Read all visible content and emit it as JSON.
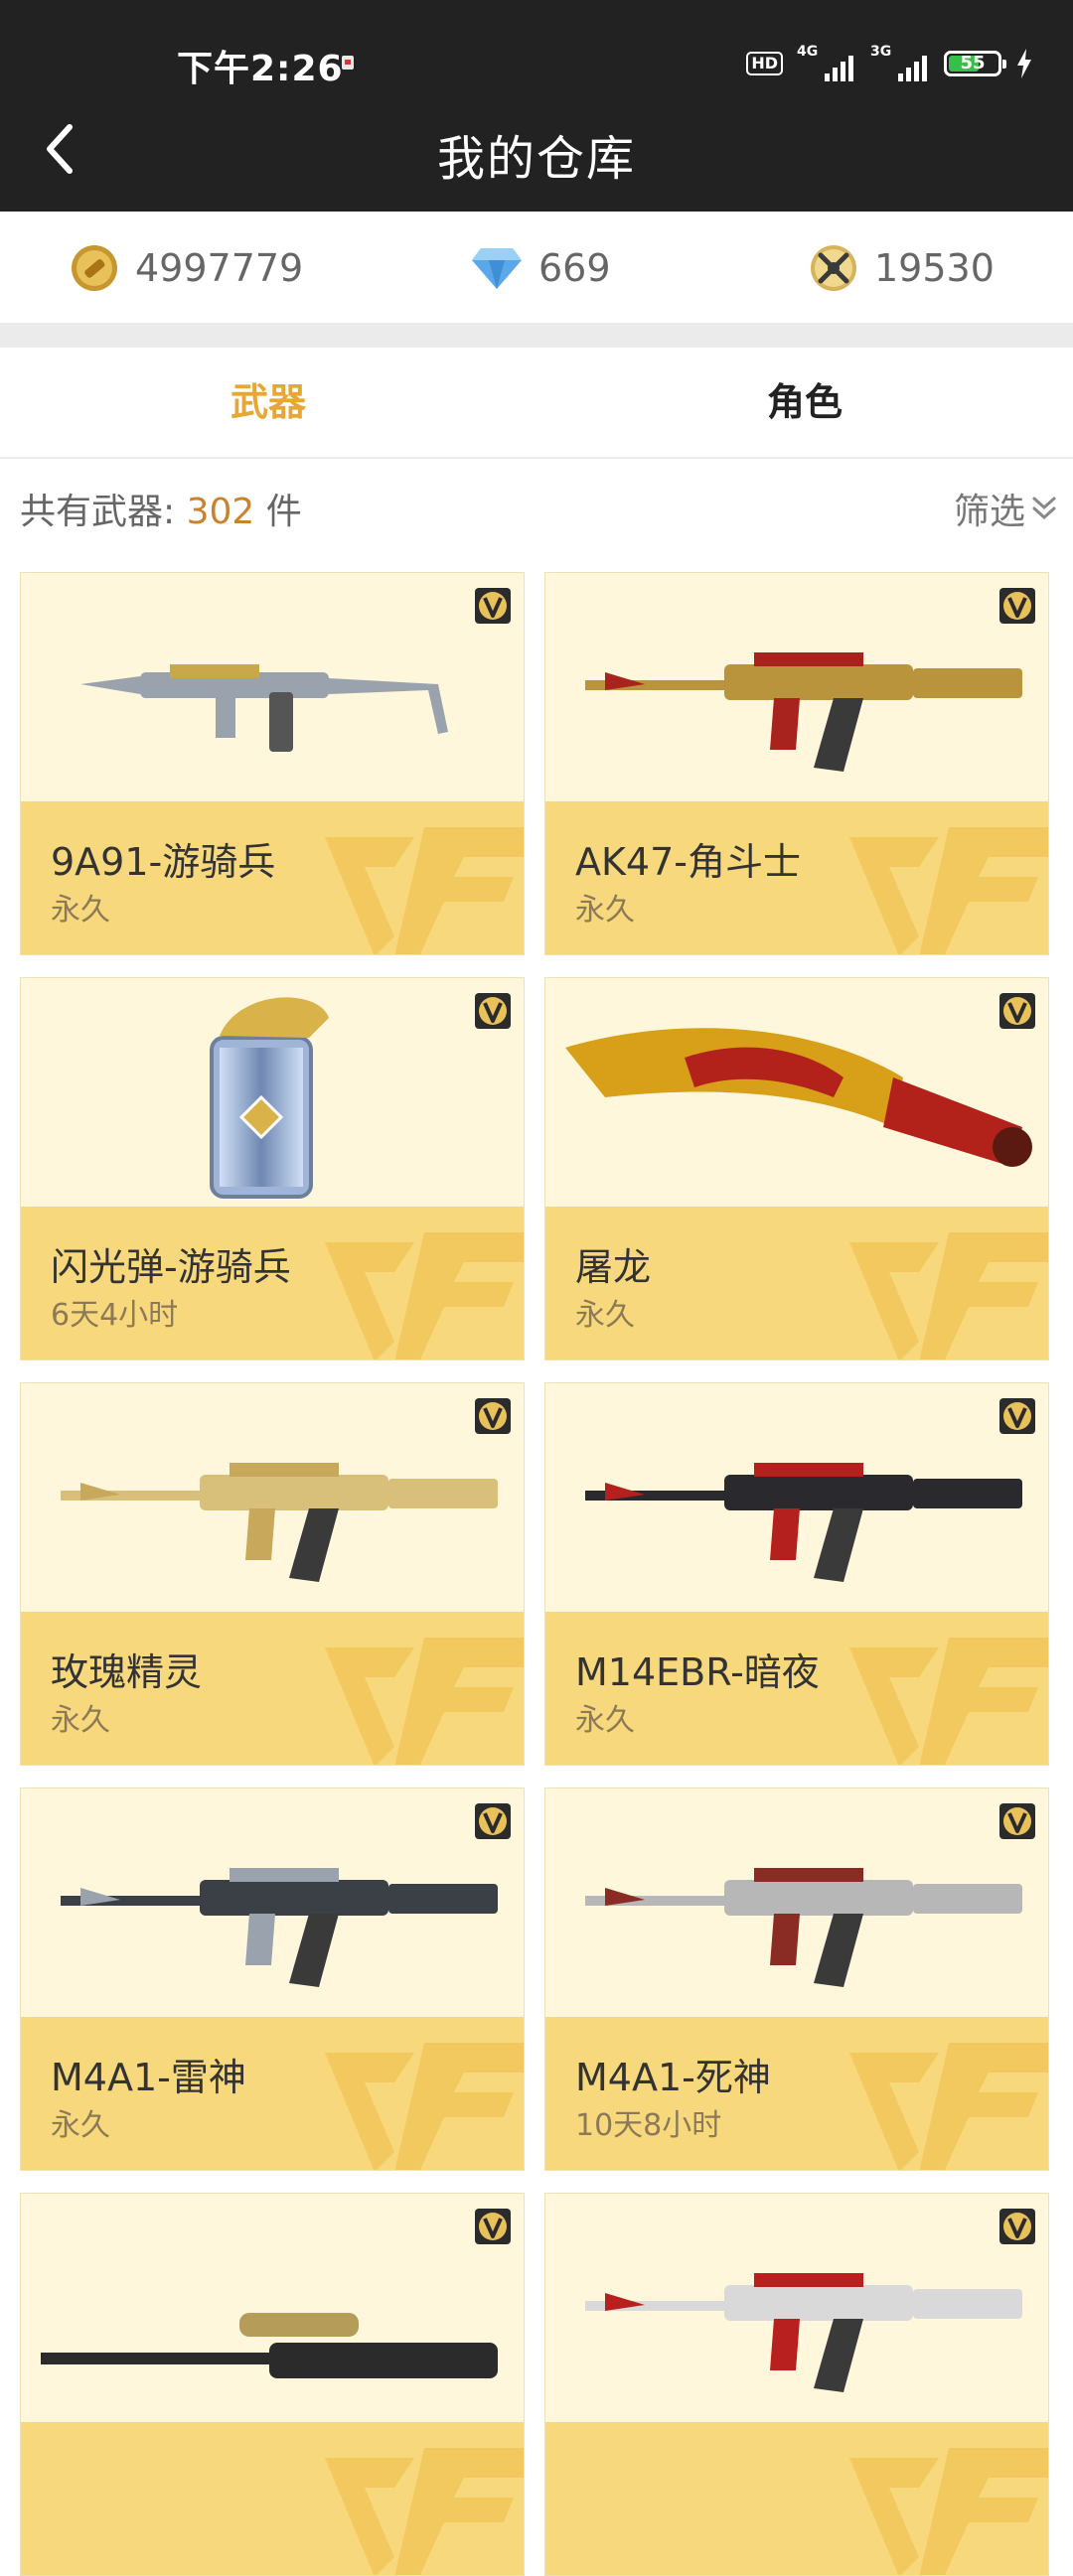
{
  "status_bar": {
    "time": "下午2:26",
    "hd": "HD",
    "net1": "4G",
    "net2": "3G",
    "battery": "55"
  },
  "header": {
    "title": "我的仓库",
    "back_icon": "back-chevron-icon"
  },
  "currency": {
    "gold": {
      "icon": "gold-coin-icon",
      "value": "4997779"
    },
    "diamond": {
      "icon": "diamond-icon",
      "value": "669"
    },
    "ticket": {
      "icon": "crossed-swords-icon",
      "value": "19530"
    }
  },
  "tabs": [
    {
      "label": "武器",
      "active": true
    },
    {
      "label": "角色",
      "active": false
    }
  ],
  "summary": {
    "prefix": "共有武器:",
    "count": "302",
    "suffix": "件",
    "filter_label": "筛选"
  },
  "items": [
    {
      "name": "9A91-游骑兵",
      "duration": "永久",
      "art": "smg",
      "palette": [
        "#9aa3ad",
        "#c9a84c"
      ]
    },
    {
      "name": "AK47-角斗士",
      "duration": "永久",
      "art": "rifle",
      "palette": [
        "#b9943c",
        "#a8231d"
      ]
    },
    {
      "name": "闪光弹-游骑兵",
      "duration": "6天4小时",
      "art": "grenade",
      "palette": [
        "#9fb4d6",
        "#d9b24a"
      ]
    },
    {
      "name": "屠龙",
      "duration": "永久",
      "art": "knife",
      "palette": [
        "#d8a018",
        "#b3221a"
      ]
    },
    {
      "name": "玫瑰精灵",
      "duration": "永久",
      "art": "rifle",
      "palette": [
        "#d9c07a",
        "#c8a85a"
      ]
    },
    {
      "name": "M14EBR-暗夜",
      "duration": "永久",
      "art": "rifle",
      "palette": [
        "#2a2a2e",
        "#b4201e"
      ]
    },
    {
      "name": "M4A1-雷神",
      "duration": "永久",
      "art": "rifle",
      "palette": [
        "#3b3f46",
        "#9aa2ad"
      ]
    },
    {
      "name": "M4A1-死神",
      "duration": "10天8小时",
      "art": "rifle",
      "palette": [
        "#b7b7b7",
        "#8a2b24"
      ]
    },
    {
      "name": "",
      "duration": "",
      "art": "sniper",
      "palette": [
        "#2b2b2b",
        "#b59c58"
      ]
    },
    {
      "name": "",
      "duration": "",
      "art": "rifle",
      "palette": [
        "#d9d9d9",
        "#b81f1f"
      ]
    }
  ],
  "colors": {
    "header_bg": "#222222",
    "accent": "#e8a734",
    "count": "#c9822e",
    "card_bg": "#fef7dc",
    "card_band": "#f8d87c"
  }
}
